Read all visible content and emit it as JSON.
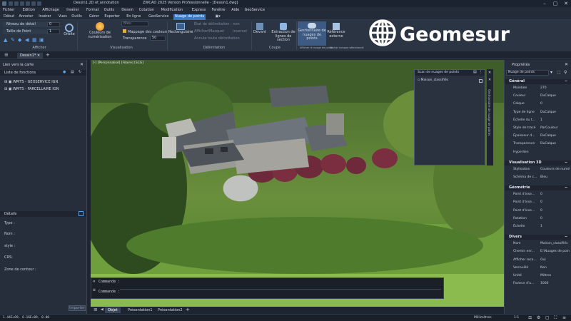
{
  "titlebar": {
    "title": "Dessin1.2D et annotation   -   ZWCAD 2025 Version Professionnelle - [Dessin1.dwg]",
    "workspace": "Dessin1.2D et annotation",
    "app_title": "ZWCAD 2025 Version Professionnelle - [Dessin1.dwg]"
  },
  "menubar": [
    "Fichier",
    "Edition",
    "Affichage",
    "Insérer",
    "Format",
    "Outils",
    "Dessin",
    "Cotation",
    "Modification",
    "Express",
    "Fenêtre",
    "Aide",
    "GeoService"
  ],
  "ribbon_tabs": [
    {
      "label": "Début"
    },
    {
      "label": "Annoter"
    },
    {
      "label": "Insérer"
    },
    {
      "label": "Vues"
    },
    {
      "label": "Outils"
    },
    {
      "label": "Gérer"
    },
    {
      "label": "Exporter"
    },
    {
      "label": "En ligne"
    },
    {
      "label": "GeoService"
    },
    {
      "label": "Nuage de points",
      "active": true
    }
  ],
  "ribbon": {
    "niveau_detail_label": "Niveau de détail",
    "niveau_detail_value": "0",
    "taille_point_label": "Taille de Point",
    "taille_point_value": "1",
    "afficher_group": "Afficher",
    "orbite": "Orbite",
    "couleurs_numerisation": "Couleurs de numérisation",
    "bleu": "Bleu",
    "mappage_couleurs": "Mappage des couleurs",
    "transparence": "Transparence",
    "transparence_value": "50",
    "visualisation_group": "Visualisation",
    "rectangulaire": "Rectangulaire",
    "etat_delimitation": "État de délimitation : non",
    "afficher_masquer": "Afficher/Masquer",
    "inverser": "Inverser",
    "annuler_delimitation": "Annule toute délimitation",
    "delimitation_group": "Délimitation",
    "devant": "Devant",
    "extraction": "Extraction de lignes de section",
    "coupe_group": "Coupe",
    "gestionnaire": "Gestionnaire de nuages de points",
    "reference_externe": "Référence externe",
    "afficher_gestionnaire": "Afficher le nuage de points",
    "activer_lorsque": "Activer lorsque sélectionné"
  },
  "logo": {
    "text": "Geomesure"
  },
  "doctab": {
    "label": "Dessin1*"
  },
  "left_panel": {
    "header": "Lien vers la carte",
    "list_label": "Liste de fonctions",
    "items": [
      "WMTS - GEOSERVICE IGN",
      "WMTS - PARCELLAIRE IGN"
    ],
    "details_header": "Détails",
    "fields": [
      "Type :",
      "Nom :",
      "style :",
      "CRS:",
      "Zone de contour :"
    ],
    "import_button": "Importer"
  },
  "viewport": {
    "label": "[-] [Personnalisé] [Filaire] [SCG]"
  },
  "cloud_panel": {
    "title": "Scan de nuages de points",
    "item": "Maison_classifiés",
    "side_label": "Gestionnaire de nuage de points"
  },
  "cmdline": {
    "line1": "Commande :",
    "line2": "Commande :"
  },
  "layout_tabs": [
    {
      "label": "Objet",
      "active": true
    },
    {
      "label": "Présentation1"
    },
    {
      "label": "Présentation2"
    }
  ],
  "statusbar": {
    "coords": "1.44E+09, 6.16E+09, 0.00",
    "units": "Millimètres",
    "scale": "1:1"
  },
  "properties": {
    "header": "Propriétés",
    "object_type": "Nuage de points",
    "sections": [
      {
        "title": "Général",
        "rows": [
          [
            "Maintien",
            "270"
          ],
          [
            "Couleur",
            "DuCalque"
          ],
          [
            "Calque",
            "0"
          ],
          [
            "Type de ligne",
            "DuCalque"
          ],
          [
            "Échelle du t...",
            "1"
          ],
          [
            "Style de tracé",
            "ParCouleur"
          ],
          [
            "Épaisseur d...",
            "DuCalque"
          ],
          [
            "Transparence",
            "DuCalque"
          ],
          [
            "Hyperlien",
            ""
          ]
        ]
      },
      {
        "title": "Visualisation 3D",
        "rows": [
          [
            "Stylisation",
            "Couleurs de numé"
          ],
          [
            "Schéma de c...",
            "Bleu"
          ]
        ]
      },
      {
        "title": "Géométrie",
        "rows": [
          [
            "Point d'inse...",
            "0"
          ],
          [
            "Point d'inse...",
            "0"
          ],
          [
            "Point d'inse...",
            "0"
          ],
          [
            "Rotation",
            "0"
          ],
          [
            "Échelle",
            "1"
          ]
        ]
      },
      {
        "title": "Divers",
        "rows": [
          [
            "Nom",
            "Maison_classifiés"
          ],
          [
            "Chemin enr...",
            "E:\\Nuages de poin"
          ],
          [
            "Afficher reca...",
            "Oui"
          ],
          [
            "Verrouillé",
            "Non"
          ],
          [
            "Unité",
            "Mètres"
          ],
          [
            "Facteur d'u...",
            "1000"
          ]
        ]
      }
    ]
  },
  "colors": {
    "accent": "#3d78c2",
    "panel": "#262e3b",
    "ribbon": "#2b3443"
  }
}
